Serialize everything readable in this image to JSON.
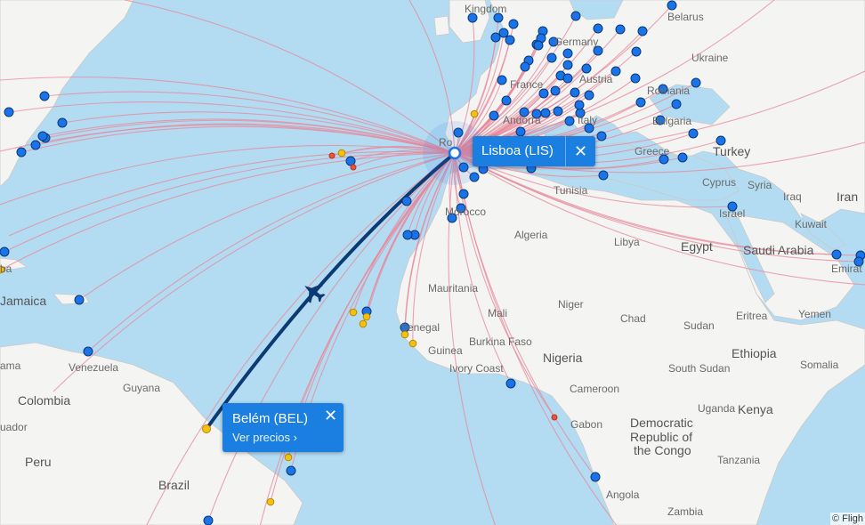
{
  "colors": {
    "sea": "#b3dcf2",
    "land": "#f4f4f2",
    "border": "#c9c9c9",
    "route": "#e8879a",
    "selected_route": "#0b3a74",
    "airport": "#1a73e8",
    "airport_stroke": "#0b3a74",
    "popup": "#1a7fe0"
  },
  "popups": {
    "origin": {
      "title": "Lisboa (LIS)"
    },
    "destination": {
      "title": "Belém (BEL)",
      "link": "Ver precios ›"
    }
  },
  "copyright": "© Fligh",
  "labels": {
    "kingdom": "Kingdom",
    "belarus": "Belarus",
    "germany": "Germany",
    "ukraine": "Ukraine",
    "france": "France",
    "austria": "Austria",
    "romania": "Romania",
    "bulgaria": "Bulgaria",
    "italy": "Italy",
    "andorra": "Andorra",
    "ro": "Ro",
    "greece": "Greece",
    "turkey": "Turkey",
    "tunisia": "Tunisia",
    "cyprus": "Cyprus",
    "syria": "Syria",
    "iraq": "Iraq",
    "iran": "Iran",
    "israel": "Israel",
    "kuwait": "Kuwait",
    "morocco": "Morocco",
    "algeria": "Algeria",
    "libya": "Libya",
    "egypt": "Egypt",
    "saudi": "Saudi Arabia",
    "emirates": "Emirat",
    "mauritania": "Mauritania",
    "mali": "Mali",
    "niger": "Niger",
    "chad": "Chad",
    "sudan": "Sudan",
    "eritrea": "Eritrea",
    "yemen": "Yemen",
    "senegal": "Senegal",
    "burkina": "Burkina Faso",
    "guinea": "Guinea",
    "ivory": "Ivory Coast",
    "nigeria": "Nigeria",
    "ethiopia": "Ethiopia",
    "somalia": "Somalia",
    "south_sudan": "South Sudan",
    "cameroon": "Cameroon",
    "gabon": "Gabon",
    "drc": [
      "Democratic",
      "Republic of",
      "the Congo"
    ],
    "uganda": "Uganda",
    "kenya": "Kenya",
    "tanzania": "Tanzania",
    "angola": "Angola",
    "zambia": "Zambia",
    "jamaica": "Jamaica",
    "venezuela": "Venezuela",
    "guyana": "Guyana",
    "colombia": "Colombia",
    "ecuador": "uador",
    "peru": "Peru",
    "brazil": "Brazil",
    "cuba": "ba",
    "panama": "ama"
  }
}
